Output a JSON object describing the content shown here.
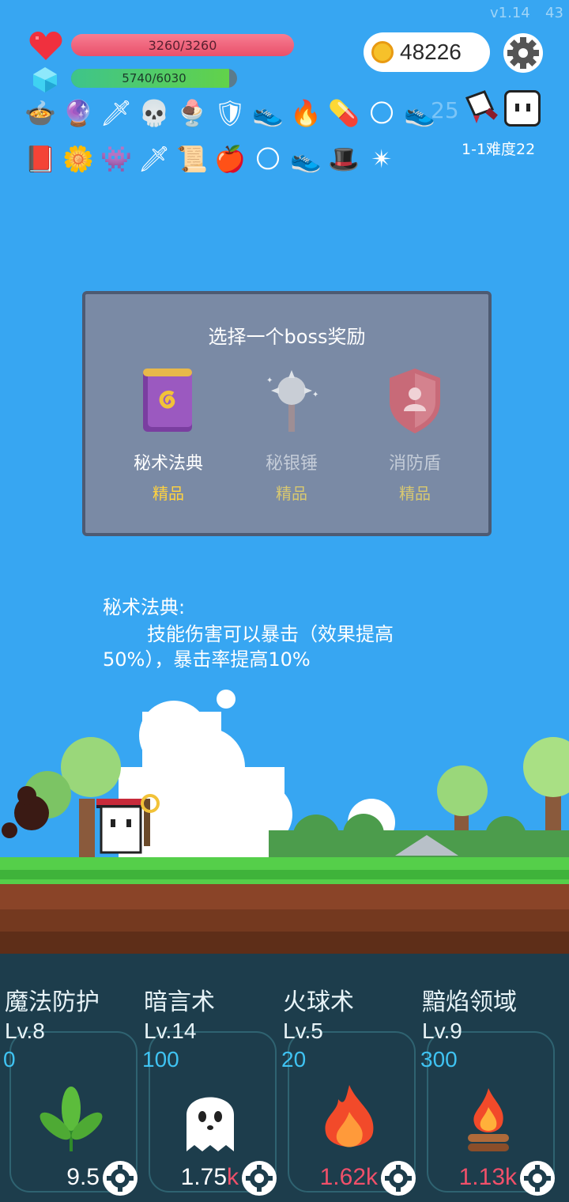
{
  "version": "v1.14",
  "version_extra": "43",
  "hp": {
    "text": "3260/3260",
    "fraction": 1.0
  },
  "mp": {
    "text": "5740/6030",
    "fraction": 0.952
  },
  "coins": "48226",
  "items_row1": [
    "cauldron-icon",
    "crystal-ball-icon",
    "sword-icon",
    "skull-book-icon",
    "ice-cream-icon",
    "shield-icon",
    "sneaker-icon",
    "fire-icon",
    "pill-icon",
    "sun-orb-icon",
    "sneaker-icon"
  ],
  "items_row2": [
    "spell-book-icon",
    "flower-icon",
    "goblin-icon",
    "sword-icon",
    "scroll-icon",
    "apple-icon",
    "sun-orb-icon",
    "sneaker-icon",
    "wizard-hat-icon",
    "spiked-ball-icon"
  ],
  "ghost_badge": "25",
  "stage": "1-1难度22",
  "panel": {
    "title": "选择一个boss奖励",
    "options": [
      {
        "name": "秘术法典",
        "quality": "精品",
        "icon": "spell-book-icon"
      },
      {
        "name": "秘银锤",
        "quality": "精品",
        "icon": "mace-icon"
      },
      {
        "name": "消防盾",
        "quality": "精品",
        "icon": "fire-shield-icon"
      }
    ]
  },
  "description": {
    "title": "秘术法典:",
    "line1": "技能伤害可以暴击（效果提高",
    "line2": "50%），暴击率提高10%"
  },
  "skills": [
    {
      "name": "魔法防护",
      "level": "Lv.8",
      "cost": "0",
      "value": "9.5",
      "unit": "",
      "icon": "leaf-icon"
    },
    {
      "name": "暗言术",
      "level": "Lv.14",
      "cost": "100",
      "value": "1.75",
      "unit": "k",
      "icon": "ghost-icon"
    },
    {
      "name": "火球术",
      "level": "Lv.5",
      "cost": "20",
      "value": "1.62",
      "unit": "k",
      "icon": "fireball-icon"
    },
    {
      "name": "黯焰领域",
      "level": "Lv.9",
      "cost": "300",
      "value": "1.13",
      "unit": "k",
      "icon": "campfire-icon"
    }
  ],
  "colors": {
    "sky": "#37a6f2",
    "hp": "#f0607a",
    "mp": "#62d24a",
    "quality": "#ffd23f",
    "skill_bg": "#1d3d4c"
  }
}
